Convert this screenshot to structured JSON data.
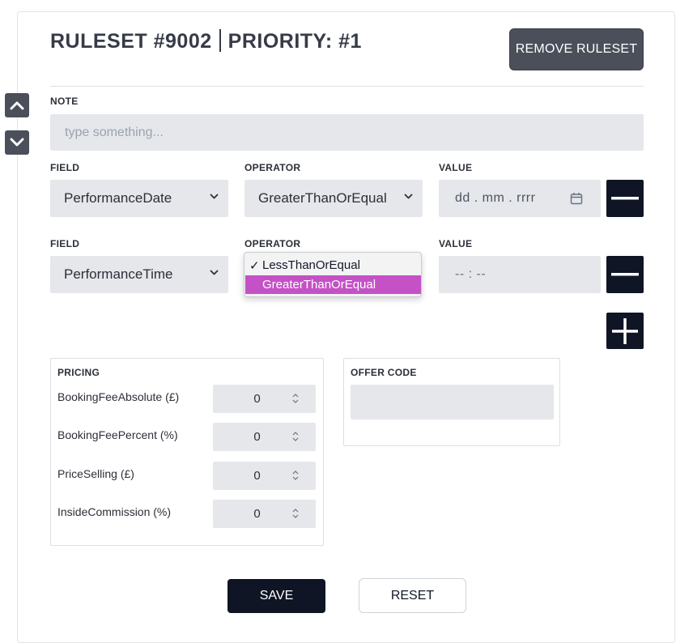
{
  "header": {
    "ruleset_label": "RULESET #9002",
    "priority_label": "PRIORITY: #1",
    "remove_button": "REMOVE RULESET"
  },
  "note": {
    "label": "NOTE",
    "placeholder": "type something...",
    "value": ""
  },
  "conditions": [
    {
      "field_label": "FIELD",
      "field_value": "PerformanceDate",
      "operator_label": "OPERATOR",
      "operator_value": "GreaterThanOrEqual",
      "value_label": "VALUE",
      "value_display": "dd . mm . rrrr"
    },
    {
      "field_label": "FIELD",
      "field_value": "PerformanceTime",
      "operator_label": "OPERATOR",
      "operator_value": "GreaterThanOrEqual",
      "value_label": "VALUE",
      "value_display": "-- : --"
    }
  ],
  "operator_dropdown": {
    "options": [
      {
        "label": "LessThanOrEqual",
        "checked": true,
        "highlighted": false
      },
      {
        "label": "GreaterThanOrEqual",
        "checked": false,
        "highlighted": true
      }
    ],
    "check_glyph": "✓"
  },
  "pricing": {
    "title": "PRICING",
    "rows": [
      {
        "label": "BookingFeeAbsolute (£)",
        "value": "0"
      },
      {
        "label": "BookingFeePercent (%)",
        "value": "0"
      },
      {
        "label": "PriceSelling (£)",
        "value": "0"
      },
      {
        "label": "InsideCommission (%)",
        "value": "0"
      }
    ]
  },
  "offer_code": {
    "title": "OFFER CODE",
    "value": ""
  },
  "footer": {
    "save_label": "SAVE",
    "reset_label": "RESET"
  },
  "colors": {
    "primary_dark": "#0f1525",
    "secondary_dark": "#4a4f5a",
    "input_bg": "#e5e7eb",
    "dropdown_highlight": "#c451c6"
  },
  "icons": {
    "move_up": "chevron-up-icon",
    "move_down": "chevron-down-icon",
    "remove_condition": "minus-icon",
    "add_condition": "plus-icon",
    "calendar": "calendar-icon",
    "select_caret": "chevron-down-icon",
    "number_spinner": "spinner-icon"
  }
}
